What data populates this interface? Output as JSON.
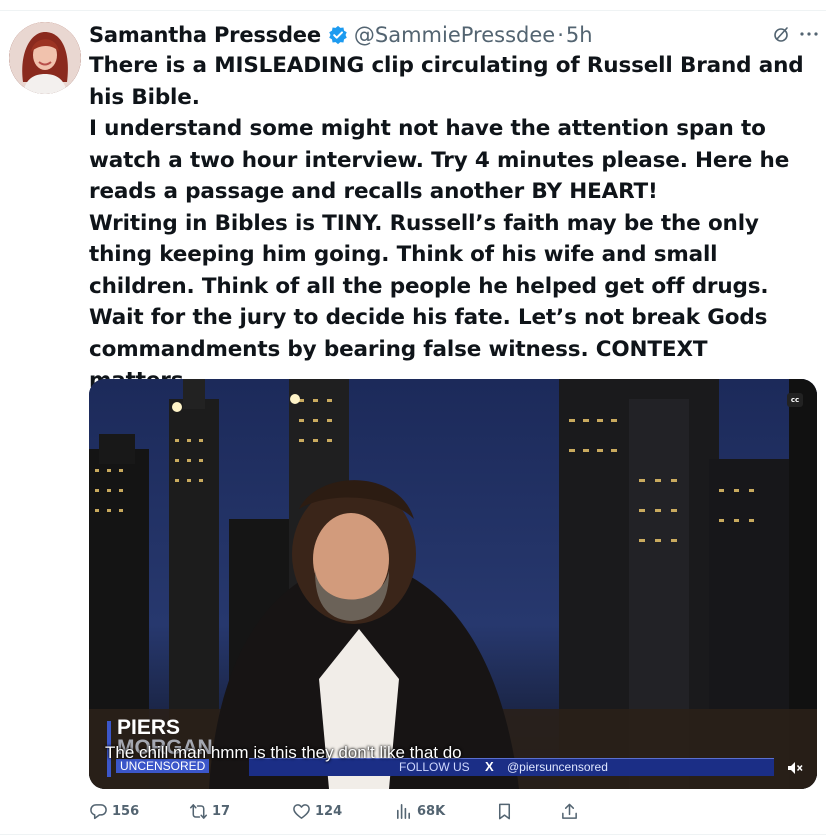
{
  "tweet": {
    "author_name": "Samantha Pressdee",
    "handle": "@SammiePressdee",
    "separator": "·",
    "time": "5h",
    "text": "There is a MISLEADING clip circulating of Russell Brand and his Bible.\nI understand some might not have the attention span to watch a two hour interview. Try 4 minutes please. Here he reads a passage and recalls another BY HEART!\nWriting in Bibles is TINY. Russell’s faith may be the only thing keeping him going. Think of his wife and small children. Think of all the people he helped get off drugs. Wait for the jury to decide his fate. Let’s not break Gods commandments by bearing false witness. CONTEXT matters."
  },
  "video": {
    "cc_label": "cc",
    "logo_line1": "PIERS",
    "logo_line2": "MORGAN",
    "logo_line3": "UNCENSORED",
    "caption": "The chill man hmm is this they don't like that do",
    "ticker_follow": "FOLLOW US",
    "ticker_x": "X",
    "ticker_handle": "@piersuncensored"
  },
  "actions": {
    "replies": "156",
    "reposts": "17",
    "likes": "124",
    "views": "68K"
  },
  "icons": [
    "verified-badge-icon",
    "grok-icon",
    "more-icon",
    "reply-icon",
    "repost-icon",
    "like-icon",
    "views-icon",
    "bookmark-icon",
    "share-icon",
    "mute-icon"
  ],
  "colors": {
    "accent": "#1d9bf0",
    "muted": "#536471",
    "text": "#0f1419"
  }
}
